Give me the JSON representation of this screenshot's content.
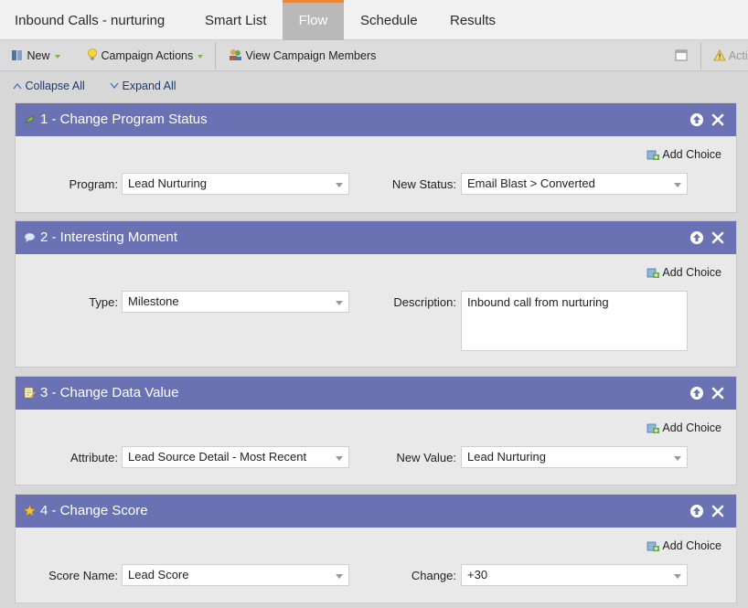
{
  "tabs": [
    {
      "label": "Inbound Calls - nurturing",
      "active": false
    },
    {
      "label": "Smart List",
      "active": false
    },
    {
      "label": "Flow",
      "active": true
    },
    {
      "label": "Schedule",
      "active": false
    },
    {
      "label": "Results",
      "active": false
    }
  ],
  "toolbar": {
    "new_label": "New",
    "campaign_actions_label": "Campaign Actions",
    "view_members_label": "View Campaign Members",
    "activity_label": "Acti"
  },
  "expand": {
    "collapse_all": "Collapse All",
    "expand_all": "Expand All"
  },
  "add_choice_label": "Add Choice",
  "steps": [
    {
      "title": "1 - Change Program Status",
      "icon": "program-status-icon",
      "fields": [
        {
          "label": "Program:",
          "value": "Lead Nurturing"
        },
        {
          "label": "New Status:",
          "value": "Email Blast > Converted"
        }
      ]
    },
    {
      "title": "2 - Interesting Moment",
      "icon": "speech-bubble-icon",
      "fields": [
        {
          "label": "Type:",
          "value": "Milestone"
        },
        {
          "label": "Description:",
          "value": "Inbound call from nurturing"
        }
      ]
    },
    {
      "title": "3 - Change Data Value",
      "icon": "data-value-icon",
      "fields": [
        {
          "label": "Attribute:",
          "value": "Lead Source Detail - Most Recent"
        },
        {
          "label": "New Value:",
          "value": "Lead Nurturing"
        }
      ]
    },
    {
      "title": "4 - Change Score",
      "icon": "star-icon",
      "fields": [
        {
          "label": "Score Name:",
          "value": "Lead Score"
        },
        {
          "label": "Change:",
          "value": "+30"
        }
      ]
    }
  ],
  "colors": {
    "step_header": "#6a72b3",
    "active_tab_accent": "#e98635",
    "active_tab_bg": "#b9b9b9"
  }
}
